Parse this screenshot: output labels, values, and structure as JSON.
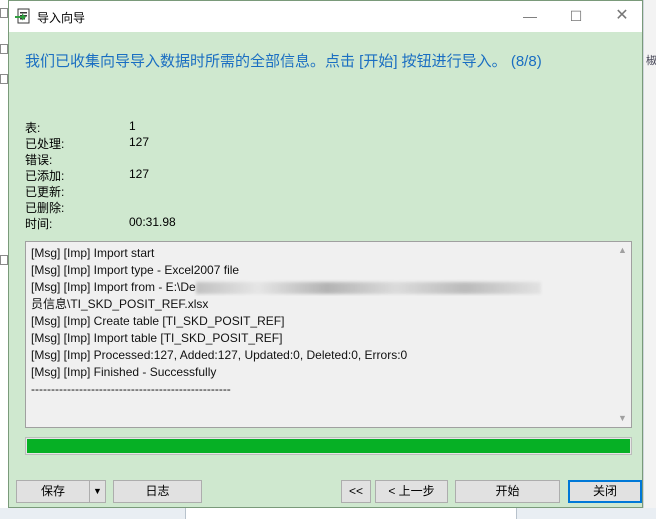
{
  "window": {
    "title": "导入向导",
    "minimize_glyph": "—",
    "maximize_glyph": "☐",
    "close_glyph": "✕"
  },
  "headline": "我们已收集向导导入数据时所需的全部信息。点击 [开始] 按钮进行导入。 (8/8)",
  "stats": [
    {
      "label": "表:",
      "value": "1"
    },
    {
      "label": "已处理:",
      "value": "127"
    },
    {
      "label": "错误:",
      "value": ""
    },
    {
      "label": "已添加:",
      "value": "127"
    },
    {
      "label": "已更新:",
      "value": ""
    },
    {
      "label": "已删除:",
      "value": ""
    },
    {
      "label": "时间:",
      "value": "00:31.98"
    }
  ],
  "log": {
    "lines": [
      "[Msg] [Imp] Import start",
      "[Msg] [Imp] Import type - Excel2007 file",
      "[Msg] [Imp] Import from - E:\\De",
      "员信息\\TI_SKD_POSIT_REF.xlsx",
      "[Msg] [Imp] Create table [TI_SKD_POSIT_REF]",
      "[Msg] [Imp] Import table [TI_SKD_POSIT_REF]",
      "[Msg] [Imp] Processed:127, Added:127, Updated:0, Deleted:0, Errors:0",
      "[Msg] [Imp] Finished - Successfully",
      "--------------------------------------------------"
    ],
    "scroll_up_glyph": "▲",
    "scroll_down_glyph": "▼"
  },
  "progress": {
    "fraction": 1.0,
    "color": "#06b025"
  },
  "buttons": {
    "save": "保存",
    "save_dropdown": "▼",
    "log": "日志",
    "first": "<<",
    "prev": "< 上一步",
    "start": "开始",
    "close": "关闭"
  },
  "background": {
    "right_glyph": "椒"
  },
  "colors": {
    "headline": "#1a6ec2",
    "window_bg": "#cfe8cf",
    "accent": "#0078d7"
  }
}
